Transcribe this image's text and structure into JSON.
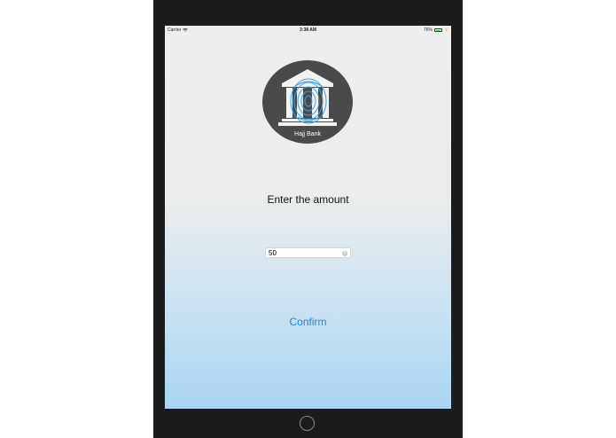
{
  "status_bar": {
    "carrier": "Carrier",
    "time": "3:38 AM",
    "battery_percent": "76%",
    "battery_level": 0.76,
    "wifi_icon": "wifi-icon",
    "battery_icon": "battery-icon",
    "charging_icon": "bolt-icon"
  },
  "logo": {
    "text": "Hajj Bank",
    "icon": "bank-fingerprint-icon",
    "circle_color": "#4a4a4a",
    "fingerprint_color": "#3aa7e8"
  },
  "form": {
    "prompt": "Enter the amount",
    "amount_value": "50",
    "clear_icon": "clear-icon"
  },
  "actions": {
    "confirm_label": "Confirm",
    "accent_color": "#1c86e0"
  }
}
